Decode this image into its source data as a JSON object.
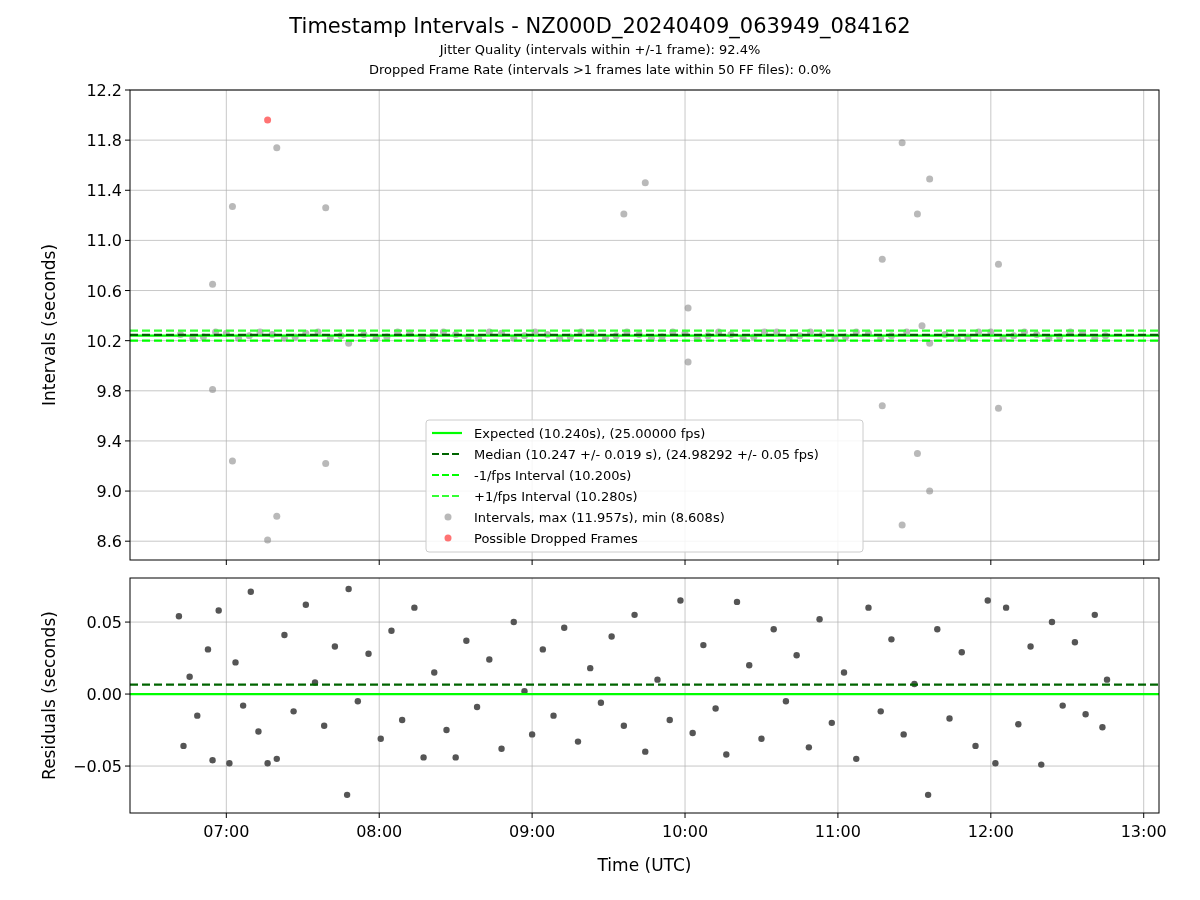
{
  "figure": {
    "title": "Timestamp Intervals - NZ000D_20240409_063949_084162",
    "subtitles": [
      "Jitter Quality (intervals within +/-1 frame): 92.4%",
      "Dropped Frame Rate (intervals >1 frames late within 50 FF files): 0.0%"
    ]
  },
  "intervals_plot": {
    "chart_data": {
      "type": "scatter",
      "ylabel": "Intervals (seconds)",
      "xlim": [
        6.37,
        13.1
      ],
      "ylim": [
        8.45,
        12.2
      ],
      "grid": true,
      "legend": true,
      "yticks": [
        {
          "value": 8.6,
          "label": "8.6"
        },
        {
          "value": 9.0,
          "label": "9.0"
        },
        {
          "value": 9.4,
          "label": "9.4"
        },
        {
          "value": 9.8,
          "label": "9.8"
        },
        {
          "value": 10.2,
          "label": "10.2"
        },
        {
          "value": 10.6,
          "label": "10.6"
        },
        {
          "value": 11.0,
          "label": "11.0"
        },
        {
          "value": 11.4,
          "label": "11.4"
        },
        {
          "value": 11.8,
          "label": "11.8"
        },
        {
          "value": 12.2,
          "label": "12.2"
        }
      ],
      "ref_lines": [
        {
          "axis": "y",
          "value": 10.24,
          "label": "Expected (10.240s), (25.00000 fps)",
          "color": "#00ff00"
        },
        {
          "axis": "y",
          "value": 10.247,
          "label": "Median (10.247 +/- 0.019 s), (24.98292 +/- 0.05 fps)",
          "color": "#006400"
        },
        {
          "axis": "y",
          "value": 10.2,
          "label": "-1/fps Interval (10.200s)",
          "color": "#00ff00"
        },
        {
          "axis": "y",
          "value": 10.28,
          "label": "+1/fps Interval (10.280s)",
          "color": "#32ff32"
        }
      ],
      "series": [
        {
          "name": "Intervals, max (11.957s), min (8.608s)",
          "color": "#808080",
          "x": [
            6.7,
            6.78,
            6.85,
            6.93,
            7.0,
            7.08,
            7.15,
            7.22,
            7.3,
            7.38,
            7.45,
            7.52,
            7.6,
            7.68,
            7.75,
            7.8,
            7.9,
            7.98,
            8.05,
            8.12,
            8.2,
            8.28,
            8.35,
            8.42,
            8.5,
            8.58,
            8.65,
            8.72,
            8.8,
            8.88,
            8.95,
            9.02,
            9.1,
            9.18,
            9.25,
            9.32,
            9.4,
            9.48,
            9.55,
            9.62,
            9.7,
            9.78,
            9.85,
            9.92,
            10.0,
            10.08,
            10.15,
            10.22,
            10.3,
            10.38,
            10.45,
            10.52,
            10.6,
            10.68,
            10.75,
            10.82,
            10.9,
            10.98,
            11.05,
            11.12,
            11.2,
            11.28,
            11.35,
            11.45,
            11.55,
            11.6,
            11.7,
            11.78,
            11.85,
            11.92,
            12.0,
            12.08,
            12.15,
            12.22,
            12.3,
            12.38,
            12.45,
            12.52,
            12.6,
            12.68,
            12.75,
            6.91,
            6.91,
            7.04,
            7.04,
            7.27,
            7.33,
            7.33,
            7.65,
            7.65,
            9.6,
            9.74,
            10.02,
            10.02,
            11.42,
            11.42,
            11.29,
            11.29,
            11.52,
            11.52,
            11.6,
            11.6,
            12.05,
            12.05
          ],
          "values": [
            10.25,
            10.22,
            10.23,
            10.27,
            10.26,
            10.22,
            10.24,
            10.27,
            10.25,
            10.22,
            10.23,
            10.26,
            10.27,
            10.22,
            10.24,
            10.18,
            10.25,
            10.22,
            10.23,
            10.27,
            10.26,
            10.22,
            10.24,
            10.27,
            10.25,
            10.22,
            10.22,
            10.27,
            10.26,
            10.22,
            10.24,
            10.27,
            10.25,
            10.22,
            10.23,
            10.27,
            10.26,
            10.22,
            10.24,
            10.27,
            10.25,
            10.22,
            10.23,
            10.27,
            10.26,
            10.22,
            10.24,
            10.27,
            10.25,
            10.22,
            10.23,
            10.27,
            10.27,
            10.22,
            10.24,
            10.27,
            10.25,
            10.22,
            10.23,
            10.27,
            10.26,
            10.22,
            10.24,
            10.27,
            10.32,
            10.18,
            10.25,
            10.22,
            10.23,
            10.27,
            10.27,
            10.22,
            10.24,
            10.27,
            10.25,
            10.22,
            10.23,
            10.27,
            10.26,
            10.22,
            10.24,
            10.65,
            9.81,
            11.27,
            9.24,
            8.61,
            11.74,
            8.8,
            11.26,
            9.22,
            11.21,
            11.46,
            10.46,
            10.03,
            11.78,
            8.73,
            10.85,
            9.68,
            11.21,
            9.3,
            11.49,
            9.0,
            10.81,
            9.66
          ]
        },
        {
          "name": "Possible Dropped Frames",
          "color": "#ff0000",
          "x": [
            7.27
          ],
          "values": [
            11.96
          ]
        }
      ]
    }
  },
  "residuals_plot": {
    "chart_data": {
      "type": "scatter",
      "xlabel": "Time (UTC)",
      "ylabel": "Residuals (seconds)",
      "xlim": [
        6.37,
        13.1
      ],
      "ylim": [
        -0.0826,
        0.0806
      ],
      "xticks": [
        {
          "value": 7,
          "label": "07:00"
        },
        {
          "value": 8,
          "label": "08:00"
        },
        {
          "value": 9,
          "label": "09:00"
        },
        {
          "value": 10,
          "label": "10:00"
        },
        {
          "value": 11,
          "label": "11:00"
        },
        {
          "value": 12,
          "label": "12:00"
        },
        {
          "value": 13,
          "label": "13:00"
        }
      ],
      "yticks": [
        {
          "value": -0.05,
          "label": "−0.05"
        },
        {
          "value": 0,
          "label": "0.00"
        },
        {
          "value": 0.05,
          "label": "0.05"
        }
      ],
      "grid": true,
      "ref_lines": [
        {
          "axis": "y",
          "value": 0,
          "color": "#00ff00"
        },
        {
          "axis": "y",
          "value": 0.0065,
          "color": "#006400"
        }
      ],
      "series": [
        {
          "color": "#555555",
          "x": [
            6.69,
            6.72,
            6.76,
            6.81,
            6.88,
            6.91,
            6.95,
            7.02,
            7.06,
            7.11,
            7.16,
            7.21,
            7.27,
            7.33,
            7.38,
            7.44,
            7.52,
            7.58,
            7.64,
            7.71,
            7.8,
            7.79,
            7.86,
            7.93,
            8.01,
            8.08,
            8.15,
            8.23,
            8.29,
            8.36,
            8.44,
            8.5,
            8.57,
            8.64,
            8.72,
            8.8,
            8.88,
            8.95,
            9.0,
            9.07,
            9.14,
            9.21,
            9.3,
            9.38,
            9.45,
            9.52,
            9.6,
            9.67,
            9.74,
            9.82,
            9.9,
            9.97,
            10.05,
            10.12,
            10.2,
            10.27,
            10.34,
            10.42,
            10.5,
            10.58,
            10.66,
            10.73,
            10.81,
            10.88,
            10.96,
            11.04,
            11.12,
            11.2,
            11.28,
            11.35,
            11.43,
            11.5,
            11.59,
            11.65,
            11.73,
            11.81,
            11.9,
            11.98,
            12.03,
            12.1,
            12.18,
            12.26,
            12.33,
            12.4,
            12.47,
            12.55,
            12.62,
            12.68,
            12.73,
            12.76
          ],
          "values": [
            0.054,
            -0.036,
            0.012,
            -0.015,
            0.031,
            -0.046,
            0.058,
            -0.048,
            0.022,
            -0.008,
            0.071,
            -0.026,
            -0.048,
            -0.045,
            0.041,
            -0.012,
            0.062,
            0.008,
            -0.022,
            0.033,
            0.073,
            -0.07,
            -0.005,
            0.028,
            -0.031,
            0.044,
            -0.018,
            0.06,
            -0.044,
            0.015,
            -0.025,
            -0.044,
            0.037,
            -0.009,
            0.024,
            -0.038,
            0.05,
            0.002,
            -0.028,
            0.031,
            -0.015,
            0.046,
            -0.033,
            0.018,
            -0.006,
            0.04,
            -0.022,
            0.055,
            -0.04,
            0.01,
            -0.018,
            0.065,
            -0.027,
            0.034,
            -0.01,
            -0.042,
            0.064,
            0.02,
            -0.031,
            0.045,
            -0.005,
            0.027,
            -0.037,
            0.052,
            -0.02,
            0.015,
            -0.045,
            0.06,
            -0.012,
            0.038,
            -0.028,
            0.007,
            -0.07,
            0.045,
            -0.017,
            0.029,
            -0.036,
            0.065,
            -0.048,
            0.06,
            -0.021,
            0.033,
            -0.049,
            0.05,
            -0.008,
            0.036,
            -0.014,
            0.055,
            -0.023,
            0.01
          ]
        }
      ]
    }
  }
}
